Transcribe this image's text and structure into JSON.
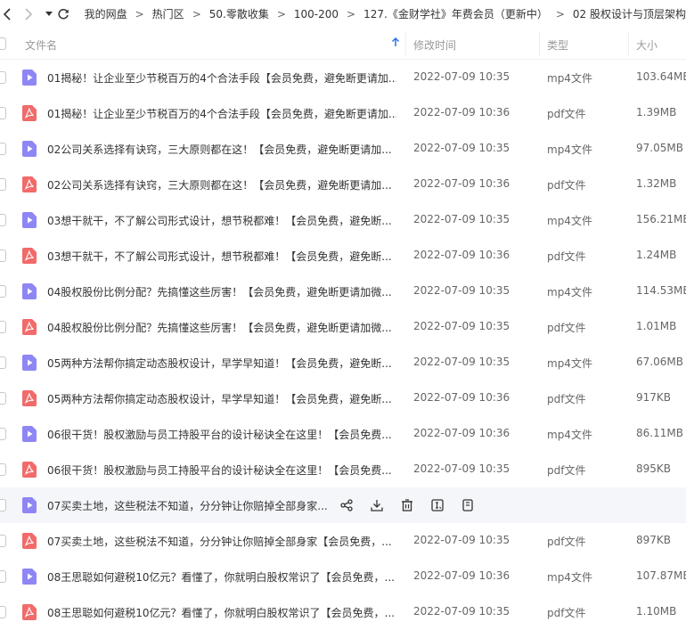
{
  "breadcrumb": [
    "我的网盘",
    "热门区",
    "50.零散收集",
    "100-200",
    "127.《金财学社》年费会员（更新中）",
    "02 股权设计与顶层架构"
  ],
  "breadcrumb_separator": ">",
  "columns": {
    "name": "文件名",
    "modified": "修改时间",
    "type": "类型",
    "size": "大小"
  },
  "colors": {
    "video_icon": "#8f86f5",
    "pdf_icon": "#f26a6a",
    "hover_row": "#f5f6fa"
  },
  "files": [
    {
      "icon": "video-file-icon",
      "name": "01揭秘！让企业至少节税百万的4个合法手段【会员免费，避免断更请加...",
      "modified": "2022-07-09 10:35",
      "type": "mp4文件",
      "size": "103.64MB"
    },
    {
      "icon": "pdf-file-icon",
      "name": "01揭秘！让企业至少节税百万的4个合法手段【会员免费，避免断更请加...",
      "modified": "2022-07-09 10:36",
      "type": "pdf文件",
      "size": "1.39MB"
    },
    {
      "icon": "video-file-icon",
      "name": "02公司关系选择有诀窍，三大原则都在这！【会员免费，避免断更请加...",
      "modified": "2022-07-09 10:35",
      "type": "mp4文件",
      "size": "97.05MB"
    },
    {
      "icon": "pdf-file-icon",
      "name": "02公司关系选择有诀窍，三大原则都在这！【会员免费，避免断更请加...",
      "modified": "2022-07-09 10:36",
      "type": "pdf文件",
      "size": "1.32MB"
    },
    {
      "icon": "video-file-icon",
      "name": "03想干就干，不了解公司形式设计，想节税都难！【会员免费，避免断...",
      "modified": "2022-07-09 10:35",
      "type": "mp4文件",
      "size": "156.21MB"
    },
    {
      "icon": "pdf-file-icon",
      "name": "03想干就干，不了解公司形式设计，想节税都难！【会员免费，避免断...",
      "modified": "2022-07-09 10:36",
      "type": "pdf文件",
      "size": "1.24MB"
    },
    {
      "icon": "video-file-icon",
      "name": "04股权股份比例分配？先搞懂这些厉害！【会员免费，避免断更请加微...",
      "modified": "2022-07-09 10:35",
      "type": "mp4文件",
      "size": "114.53MB"
    },
    {
      "icon": "pdf-file-icon",
      "name": "04股权股份比例分配？先搞懂这些厉害！【会员免费，避免断更请加微...",
      "modified": "2022-07-09 10:35",
      "type": "pdf文件",
      "size": "1.01MB"
    },
    {
      "icon": "video-file-icon",
      "name": "05两种方法帮你搞定动态股权设计，早学早知道！【会员免费，避免断...",
      "modified": "2022-07-09 10:35",
      "type": "mp4文件",
      "size": "67.06MB"
    },
    {
      "icon": "pdf-file-icon",
      "name": "05两种方法帮你搞定动态股权设计，早学早知道！【会员免费，避免断...",
      "modified": "2022-07-09 10:36",
      "type": "pdf文件",
      "size": "917KB"
    },
    {
      "icon": "video-file-icon",
      "name": "06很干货！股权激励与员工持股平台的设计秘诀全在这里！【会员免费...",
      "modified": "2022-07-09 10:36",
      "type": "mp4文件",
      "size": "86.11MB"
    },
    {
      "icon": "pdf-file-icon",
      "name": "06很干货！股权激励与员工持股平台的设计秘诀全在这里！【会员免费...",
      "modified": "2022-07-09 10:35",
      "type": "pdf文件",
      "size": "895KB"
    },
    {
      "icon": "video-file-icon",
      "name": "07买卖土地，这些税法不知道，分分钟让你赔掉全部身家...",
      "modified": "",
      "type": "",
      "size": "",
      "hover": true
    },
    {
      "icon": "pdf-file-icon",
      "name": "07买卖土地，这些税法不知道，分分钟让你赔掉全部身家【会员免费，...",
      "modified": "2022-07-09 10:35",
      "type": "pdf文件",
      "size": "897KB"
    },
    {
      "icon": "video-file-icon",
      "name": "08王思聪如何避税10亿元？看懂了，你就明白股权常识了【会员免费，...",
      "modified": "2022-07-09 10:36",
      "type": "mp4文件",
      "size": "107.87MB"
    },
    {
      "icon": "pdf-file-icon",
      "name": "08王思聪如何避税10亿元？看懂了，你就明白股权常识了【会员免费，...",
      "modified": "2022-07-09 10:35",
      "type": "pdf文件",
      "size": "1.10MB"
    }
  ],
  "hover_actions": [
    "share-icon",
    "download-icon",
    "delete-icon",
    "rename-icon",
    "more-icon"
  ]
}
